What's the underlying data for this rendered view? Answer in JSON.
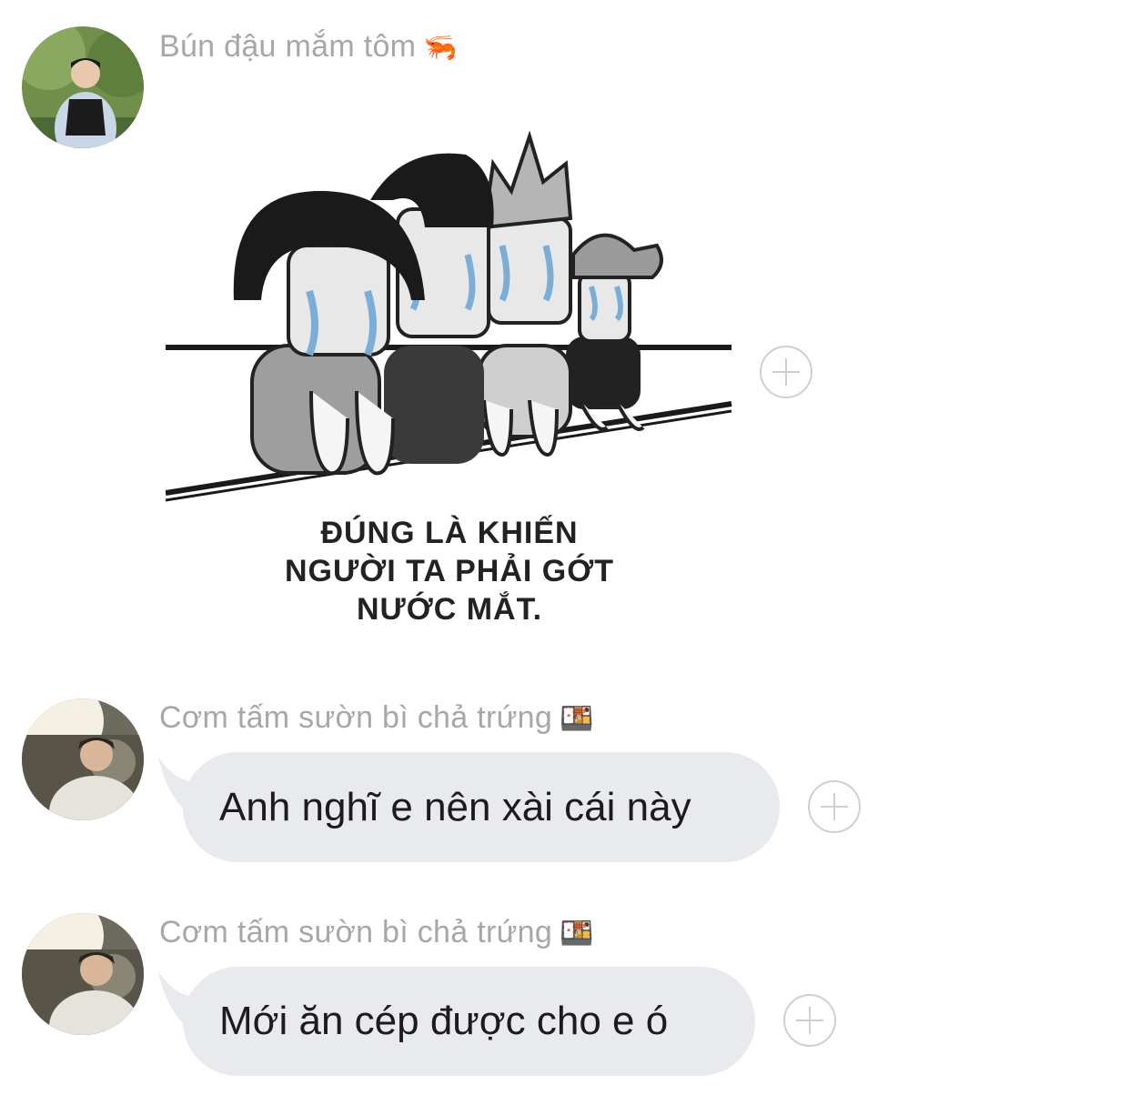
{
  "messages": [
    {
      "sender": "Bún đậu mắm tôm",
      "sender_emoji": "🦐",
      "type": "sticker",
      "sticker_caption": [
        "ĐÚNG LÀ KHIẾN",
        "NGƯỜI TA PHẢI GỚT",
        "NƯỚC MẮT."
      ]
    },
    {
      "sender": "Cơm tấm sườn bì chả trứng",
      "sender_emoji": "🍱",
      "type": "text",
      "text": "Anh nghĩ e nên xài cái này"
    },
    {
      "sender": "Cơm tấm sườn bì chả trứng",
      "sender_emoji": "🍱",
      "type": "text",
      "text": "Mới ăn cép được cho e ó"
    }
  ],
  "colors": {
    "bubble": "#e8eaed",
    "sender_text": "#a7a7a7",
    "message_text": "#1c1c1e"
  }
}
